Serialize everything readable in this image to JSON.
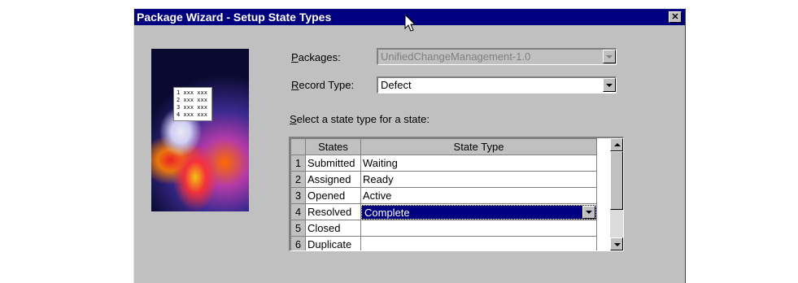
{
  "window": {
    "title": "Package Wizard - Setup State Types",
    "close_glyph": "✕"
  },
  "graphic": {
    "list_items": [
      "1 xxx xxx",
      "2 xxx xxx",
      "3 xxx xxx",
      "4 xxx xxx"
    ]
  },
  "packages": {
    "label_first": "P",
    "label_rest": "ackages:",
    "value": "UnifiedChangeManagement-1.0",
    "disabled": true
  },
  "record_type": {
    "label_first": "R",
    "label_rest": "ecord Type:",
    "value": "Defect"
  },
  "grid": {
    "prompt_first": "S",
    "prompt_rest": "elect a state type for a state:",
    "columns": [
      "States",
      "State Type"
    ],
    "rows": [
      {
        "num": "1",
        "state": "Submitted",
        "type": "Waiting"
      },
      {
        "num": "2",
        "state": "Assigned",
        "type": "Ready"
      },
      {
        "num": "3",
        "state": "Opened",
        "type": "Active"
      },
      {
        "num": "4",
        "state": "Resolved",
        "type": "Complete",
        "editing": true
      },
      {
        "num": "5",
        "state": "Closed",
        "type": ""
      },
      {
        "num": "6",
        "state": "Duplicate",
        "type": ""
      }
    ]
  },
  "colors": {
    "titlebar": "#000080",
    "dialog_bg": "#c0c0c0",
    "selection": "#000080"
  }
}
